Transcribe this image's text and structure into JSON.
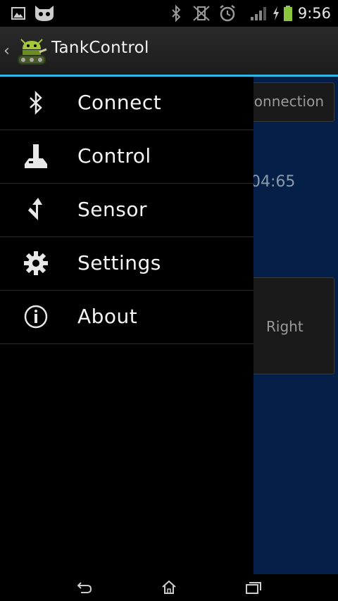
{
  "status_bar": {
    "time": "9:56",
    "left_icons": [
      "gallery-icon",
      "cyanogen-icon"
    ],
    "right_icons": [
      "bluetooth-icon",
      "vibrate-off-icon",
      "alarm-icon",
      "signal-icon",
      "charging-icon",
      "battery-icon"
    ]
  },
  "action_bar": {
    "title": "TankControl",
    "accent_color": "#33b5e5"
  },
  "background": {
    "connection_label": "connection",
    "counter_text": "04:65",
    "right_label": "Right",
    "content_color": "#052048"
  },
  "drawer": {
    "items": [
      {
        "label": "Connect",
        "icon": "bluetooth-icon"
      },
      {
        "label": "Control",
        "icon": "joystick-icon"
      },
      {
        "label": "Sensor",
        "icon": "sensor-arrow-icon"
      },
      {
        "label": "Settings",
        "icon": "gear-icon"
      },
      {
        "label": "About",
        "icon": "info-icon"
      }
    ]
  },
  "nav_bar": {
    "buttons": [
      "back-icon",
      "home-icon",
      "recents-icon"
    ]
  }
}
